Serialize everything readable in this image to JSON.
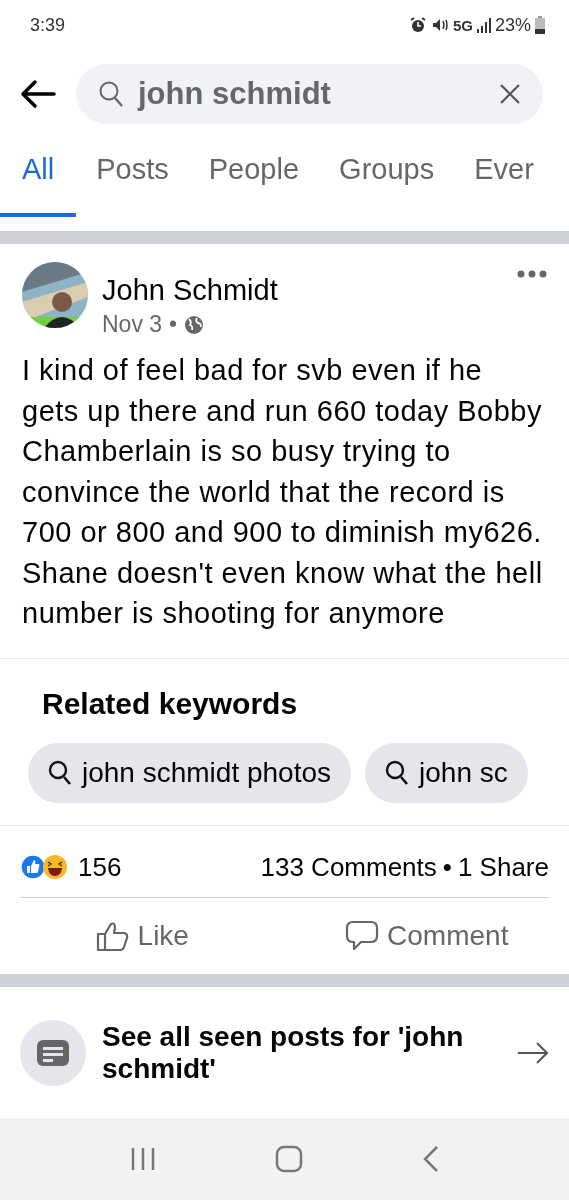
{
  "status_bar": {
    "time": "3:39",
    "battery": "23%",
    "network": "5G"
  },
  "search": {
    "value": "john schmidt"
  },
  "tabs": [
    {
      "label": "All",
      "selected": true
    },
    {
      "label": "Posts",
      "selected": false
    },
    {
      "label": "People",
      "selected": false
    },
    {
      "label": "Groups",
      "selected": false
    },
    {
      "label": "Ever",
      "selected": false
    }
  ],
  "post": {
    "author": "John Schmidt",
    "date": "Nov 3",
    "separator": "•",
    "text": "I kind of feel bad for svb even if he gets up there and run 660 today Bobby Chamberlain is so busy trying to convince the world that the record is 700 or 800 and 900 to diminish my626. Shane doesn't even know what the hell number is shooting for anymore"
  },
  "related_keywords": {
    "title": "Related keywords",
    "chips": [
      "john schmidt photos",
      "john sc"
    ]
  },
  "reactions": {
    "count": "156",
    "comments": "133 Comments",
    "separator": "•",
    "shares": "1 Share"
  },
  "actions": [
    "Like",
    "Comment"
  ],
  "see_all": {
    "text": "See all seen posts for 'john schmidt'"
  }
}
